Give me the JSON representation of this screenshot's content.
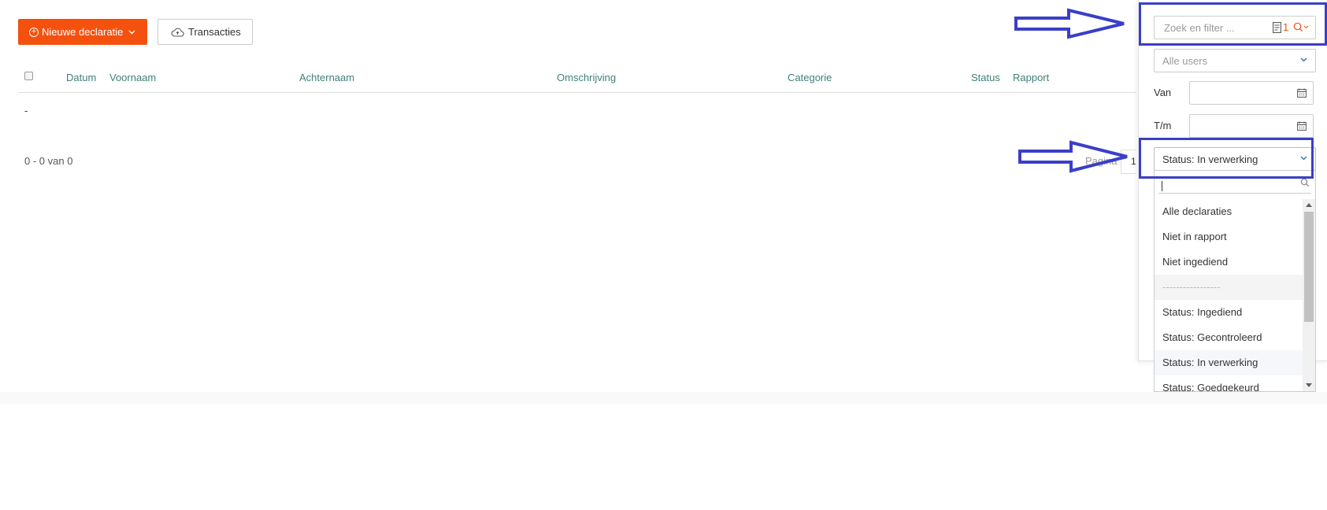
{
  "toolbar": {
    "new_claim_label": "Nieuwe declaratie",
    "transactions_label": "Transacties"
  },
  "table": {
    "columns": [
      "Datum",
      "Voornaam",
      "Achternaam",
      "Omschrijving",
      "Categorie",
      "Status",
      "Rapport"
    ],
    "empty_cell": "-"
  },
  "pagination": {
    "range_text": "0 - 0 van 0",
    "page_label": "Pagina",
    "page_value": "1"
  },
  "filter": {
    "search_placeholder": "Zoek en filter ...",
    "active_filter_count": "1",
    "users_value": "Alle users",
    "from_label": "Van",
    "to_label": "T/m",
    "status_value": "Status: In verwerking",
    "options": [
      "Alle declaraties",
      "Niet in rapport",
      "Niet ingediend",
      "-----------------",
      "Status: Ingediend",
      "Status: Gecontroleerd",
      "Status: In verwerking",
      "Status: Goedgekeurd"
    ]
  },
  "colors": {
    "primary": "#f4510f",
    "header_text": "#3e8079",
    "annotation": "#3a3fc7"
  }
}
